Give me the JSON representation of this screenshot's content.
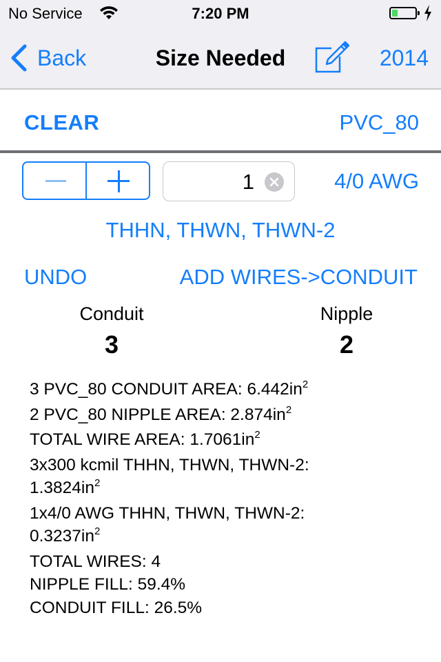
{
  "status_bar": {
    "carrier": "No Service",
    "wifi_icon": "wifi-icon",
    "time": "7:20 PM",
    "battery_level_percent": 25,
    "battery_color": "#4cd964",
    "charging_icon": "bolt-icon"
  },
  "nav": {
    "back_label": "Back",
    "title": "Size Needed",
    "compose_icon": "compose-icon",
    "year_label": "2014"
  },
  "controls": {
    "clear_label": "CLEAR",
    "conduit_type": "PVC_80",
    "quantity_value": "1",
    "wire_size": "4/0 AWG",
    "insulation": "THHN, THWN, THWN-2",
    "undo_label": "UNDO",
    "add_label": "ADD WIRES->CONDUIT"
  },
  "counts": {
    "conduit_label": "Conduit",
    "conduit_value": "3",
    "nipple_label": "Nipple",
    "nipple_value": "2"
  },
  "results": [
    {
      "text": "3 PVC_80 CONDUIT AREA: 6.442in",
      "sup": "2"
    },
    {
      "text": "2 PVC_80 NIPPLE AREA: 2.874in",
      "sup": "2"
    },
    {
      "text": "TOTAL WIRE AREA: 1.7061in",
      "sup": "2"
    },
    {
      "text": "3x300 kcmil THHN, THWN, THWN-2:",
      "sup": ""
    },
    {
      "text": "1.3824in",
      "sup": "2"
    },
    {
      "text": "1x4/0 AWG THHN, THWN, THWN-2:",
      "sup": ""
    },
    {
      "text": "0.3237in",
      "sup": "2"
    },
    {
      "text": "TOTAL WIRES: 4",
      "sup": ""
    },
    {
      "text": "NIPPLE FILL: 59.4%",
      "sup": ""
    },
    {
      "text": "CONDUIT FILL: 26.5%",
      "sup": ""
    }
  ],
  "colors": {
    "accent": "#147efb",
    "nav_background": "#efeff4",
    "divider": "#6d6d72"
  }
}
